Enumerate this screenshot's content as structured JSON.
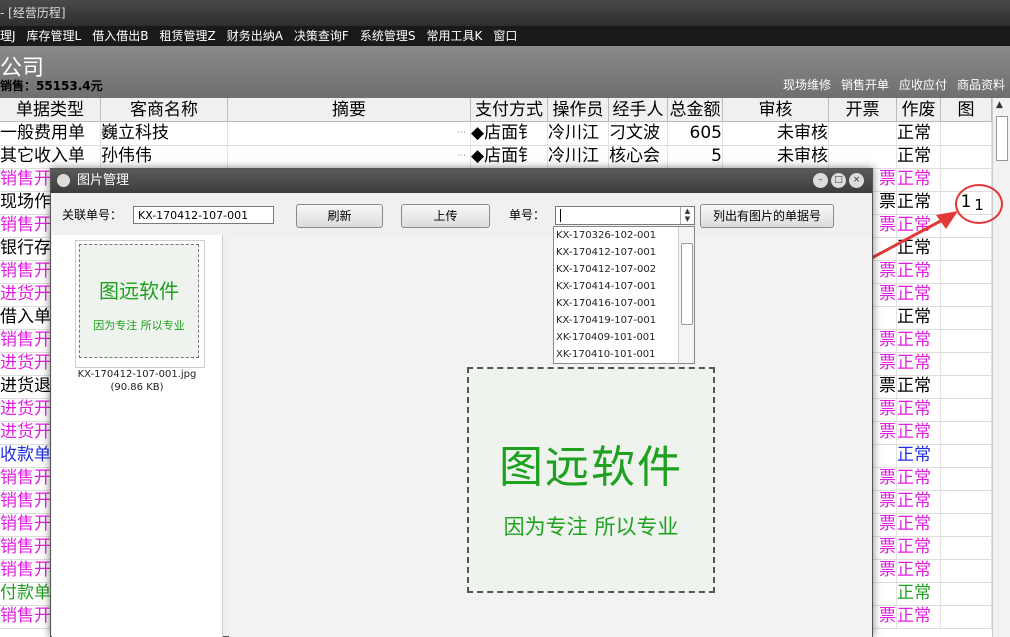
{
  "app": {
    "title": "- [经营历程]",
    "menus": [
      "理J",
      "库存管理L",
      "借入借出B",
      "租赁管理Z",
      "财务出纳A",
      "决策查询F",
      "系统管理S",
      "常用工具K",
      "窗口"
    ],
    "company": "公司",
    "sales": "销售：55153.4元",
    "quick_links": [
      "现场维修",
      "销售开单",
      "应收应付",
      "商品资料"
    ]
  },
  "table": {
    "columns": [
      "单据类型",
      "客商名称",
      "摘要",
      "支付方式",
      "操作员",
      "经手人",
      "总金额",
      "审核",
      "开票",
      "作废",
      "图"
    ],
    "rows": [
      {
        "type": "一般费用单",
        "client": "巍立科技",
        "summary": "···",
        "pay": "◆店面钅",
        "op": "冷川江",
        "handler": "刁文波",
        "amount": "605",
        "audit": "未审核",
        "invoice": "",
        "status": "正常",
        "type_color": "#000000"
      },
      {
        "type": "其它收入单",
        "client": "孙伟伟",
        "summary": "···",
        "pay": "◆店面钅",
        "op": "冷川江",
        "handler": "核心会",
        "amount": "5",
        "audit": "未审核",
        "invoice": "",
        "status": "正常",
        "type_color": "#000000"
      },
      {
        "type": "销售开",
        "client": "",
        "summary": "",
        "pay": "",
        "op": "",
        "handler": "",
        "amount": "",
        "audit": "",
        "invoice": "票",
        "status": "正常",
        "type_color": "#e020e0"
      },
      {
        "type": "现场作",
        "client": "",
        "summary": "",
        "pay": "",
        "op": "",
        "handler": "",
        "amount": "",
        "audit": "",
        "invoice": "票",
        "status": "正常",
        "type_color": "#000000",
        "pic": "1"
      },
      {
        "type": "销售开",
        "client": "",
        "summary": "",
        "pay": "",
        "op": "",
        "handler": "",
        "amount": "",
        "audit": "",
        "invoice": "票",
        "status": "正常",
        "type_color": "#e020e0"
      },
      {
        "type": "银行存",
        "client": "",
        "summary": "",
        "pay": "",
        "op": "",
        "handler": "",
        "amount": "",
        "audit": "",
        "invoice": "",
        "status": "正常",
        "type_color": "#000000"
      },
      {
        "type": "销售开",
        "client": "",
        "summary": "",
        "pay": "",
        "op": "",
        "handler": "",
        "amount": "",
        "audit": "",
        "invoice": "票",
        "status": "正常",
        "type_color": "#e020e0"
      },
      {
        "type": "进货开",
        "client": "",
        "summary": "",
        "pay": "",
        "op": "",
        "handler": "",
        "amount": "",
        "audit": "",
        "invoice": "票",
        "status": "正常",
        "type_color": "#e020e0"
      },
      {
        "type": "借入单",
        "client": "",
        "summary": "",
        "pay": "",
        "op": "",
        "handler": "",
        "amount": "",
        "audit": "",
        "invoice": "",
        "status": "正常",
        "type_color": "#000000"
      },
      {
        "type": "销售开",
        "client": "",
        "summary": "",
        "pay": "",
        "op": "",
        "handler": "",
        "amount": "",
        "audit": "",
        "invoice": "票",
        "status": "正常",
        "type_color": "#e020e0"
      },
      {
        "type": "进货开",
        "client": "",
        "summary": "",
        "pay": "",
        "op": "",
        "handler": "",
        "amount": "",
        "audit": "",
        "invoice": "票",
        "status": "正常",
        "type_color": "#e020e0"
      },
      {
        "type": "进货退",
        "client": "",
        "summary": "",
        "pay": "",
        "op": "",
        "handler": "",
        "amount": "",
        "audit": "",
        "invoice": "票",
        "status": "正常",
        "type_color": "#000000"
      },
      {
        "type": "进货开",
        "client": "",
        "summary": "",
        "pay": "",
        "op": "",
        "handler": "",
        "amount": "",
        "audit": "",
        "invoice": "票",
        "status": "正常",
        "type_color": "#e020e0"
      },
      {
        "type": "进货开",
        "client": "",
        "summary": "",
        "pay": "",
        "op": "",
        "handler": "",
        "amount": "",
        "audit": "",
        "invoice": "票",
        "status": "正常",
        "type_color": "#e020e0"
      },
      {
        "type": "收款单",
        "client": "",
        "summary": "",
        "pay": "",
        "op": "",
        "handler": "",
        "amount": "",
        "audit": "",
        "invoice": "",
        "status": "正常",
        "type_color": "#2030e0"
      },
      {
        "type": "销售开",
        "client": "",
        "summary": "",
        "pay": "",
        "op": "",
        "handler": "",
        "amount": "",
        "audit": "",
        "invoice": "票",
        "status": "正常",
        "type_color": "#e020e0"
      },
      {
        "type": "销售开",
        "client": "",
        "summary": "",
        "pay": "",
        "op": "",
        "handler": "",
        "amount": "",
        "audit": "",
        "invoice": "票",
        "status": "正常",
        "type_color": "#e020e0"
      },
      {
        "type": "销售开",
        "client": "",
        "summary": "",
        "pay": "",
        "op": "",
        "handler": "",
        "amount": "",
        "audit": "",
        "invoice": "票",
        "status": "正常",
        "type_color": "#e020e0"
      },
      {
        "type": "销售开",
        "client": "",
        "summary": "",
        "pay": "",
        "op": "",
        "handler": "",
        "amount": "",
        "audit": "",
        "invoice": "票",
        "status": "正常",
        "type_color": "#e020e0"
      },
      {
        "type": "销售开",
        "client": "",
        "summary": "",
        "pay": "",
        "op": "",
        "handler": "",
        "amount": "",
        "audit": "",
        "invoice": "票",
        "status": "正常",
        "type_color": "#e020e0"
      },
      {
        "type": "付款单",
        "client": "",
        "summary": "",
        "pay": "",
        "op": "",
        "handler": "",
        "amount": "",
        "audit": "",
        "invoice": "",
        "status": "正常",
        "type_color": "#20a020"
      },
      {
        "type": "销售开",
        "client": "",
        "summary": "",
        "pay": "",
        "op": "",
        "handler": "",
        "amount": "",
        "audit": "",
        "invoice": "票",
        "status": "正常",
        "type_color": "#e020e0"
      }
    ]
  },
  "dialog": {
    "title": "图片管理",
    "related_label": "关联单号：",
    "related_value": "KX-170412-107-001",
    "refresh": "刷新",
    "upload": "上传",
    "doc_label": "单号：",
    "list_button": "列出有图片的单据号",
    "dropdown_options": [
      "KX-170326-102-001",
      "KX-170412-107-001",
      "KX-170412-107-002",
      "KX-170414-107-001",
      "KX-170416-107-001",
      "KX-170419-107-001",
      "XK-170409-101-001",
      "XK-170410-101-001"
    ],
    "thumbnail_name": "KX-170412-107-001.jpg",
    "thumbnail_size": "(90.86 KB)",
    "logo_title": "图远软件",
    "logo_slogan": "因为专注  所以专业"
  },
  "colors": {
    "accent_red": "#e23a3a",
    "logo_green": "#1ea11e"
  }
}
